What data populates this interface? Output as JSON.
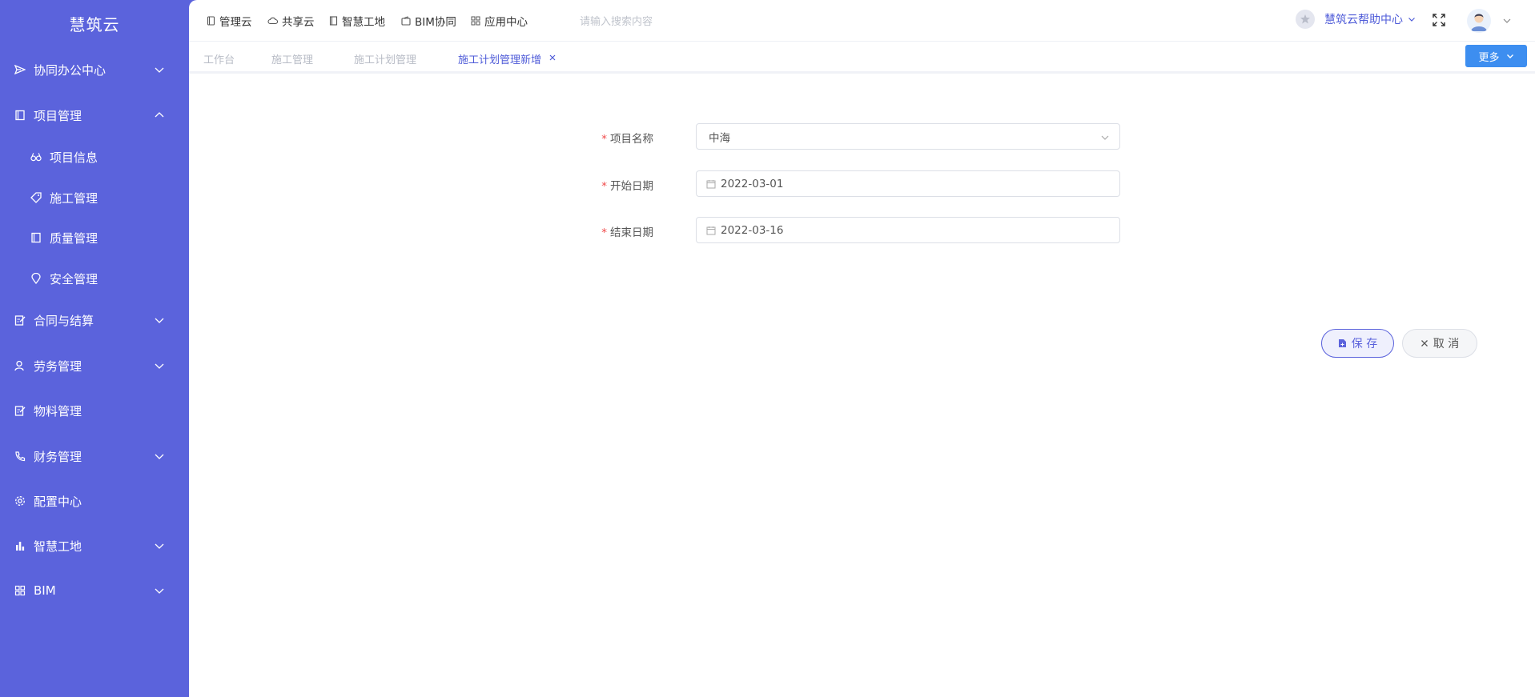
{
  "brand": "慧筑云",
  "sidebar": {
    "items": [
      {
        "label": "协同办公中心",
        "icon": "send-icon",
        "expandable": true
      },
      {
        "label": "项目管理",
        "icon": "book-icon",
        "expandable": true,
        "expanded": true
      },
      {
        "label": "项目信息",
        "icon": "glasses-icon",
        "sub": true
      },
      {
        "label": "施工管理",
        "icon": "tag-icon",
        "sub": true
      },
      {
        "label": "质量管理",
        "icon": "book-icon",
        "sub": true
      },
      {
        "label": "安全管理",
        "icon": "location-icon",
        "sub": true
      },
      {
        "label": "合同与结算",
        "icon": "edit-icon",
        "expandable": true
      },
      {
        "label": "劳务管理",
        "icon": "user-icon",
        "expandable": true
      },
      {
        "label": "物料管理",
        "icon": "edit-icon",
        "expandable": false
      },
      {
        "label": "财务管理",
        "icon": "phone-icon",
        "expandable": true
      },
      {
        "label": "配置中心",
        "icon": "gear-icon",
        "expandable": false
      },
      {
        "label": "智慧工地",
        "icon": "bar-chart-icon",
        "expandable": true
      },
      {
        "label": "BIM",
        "icon": "grid-icon",
        "expandable": true
      }
    ]
  },
  "topnav": {
    "items": [
      {
        "label": "管理云",
        "icon": "tablet-icon"
      },
      {
        "label": "共享云",
        "icon": "cloud-icon"
      },
      {
        "label": "智慧工地",
        "icon": "book-icon"
      },
      {
        "label": "BIM协同",
        "icon": "wallet-icon"
      },
      {
        "label": "应用中心",
        "icon": "grid-icon"
      }
    ],
    "search_placeholder": "请输入搜索内容",
    "help_label": "慧筑云帮助中心"
  },
  "tabs": {
    "items": [
      {
        "label": "工作台"
      },
      {
        "label": "施工管理"
      },
      {
        "label": "施工计划管理"
      },
      {
        "label": "施工计划管理新增",
        "active": true
      }
    ],
    "more_label": "更多"
  },
  "form": {
    "project_name_label": "项目名称",
    "project_name_value": "中海",
    "start_date_label": "开始日期",
    "start_date_value": "2022-03-01",
    "end_date_label": "结束日期",
    "end_date_value": "2022-03-16",
    "required_mark": "*"
  },
  "actions": {
    "save_label": "保 存",
    "cancel_label": "取 消"
  },
  "colors": {
    "sidebar_bg": "#5b63dc",
    "accent": "#4e5bd8",
    "more_button": "#3d8ef0",
    "required": "#f04a4a"
  }
}
